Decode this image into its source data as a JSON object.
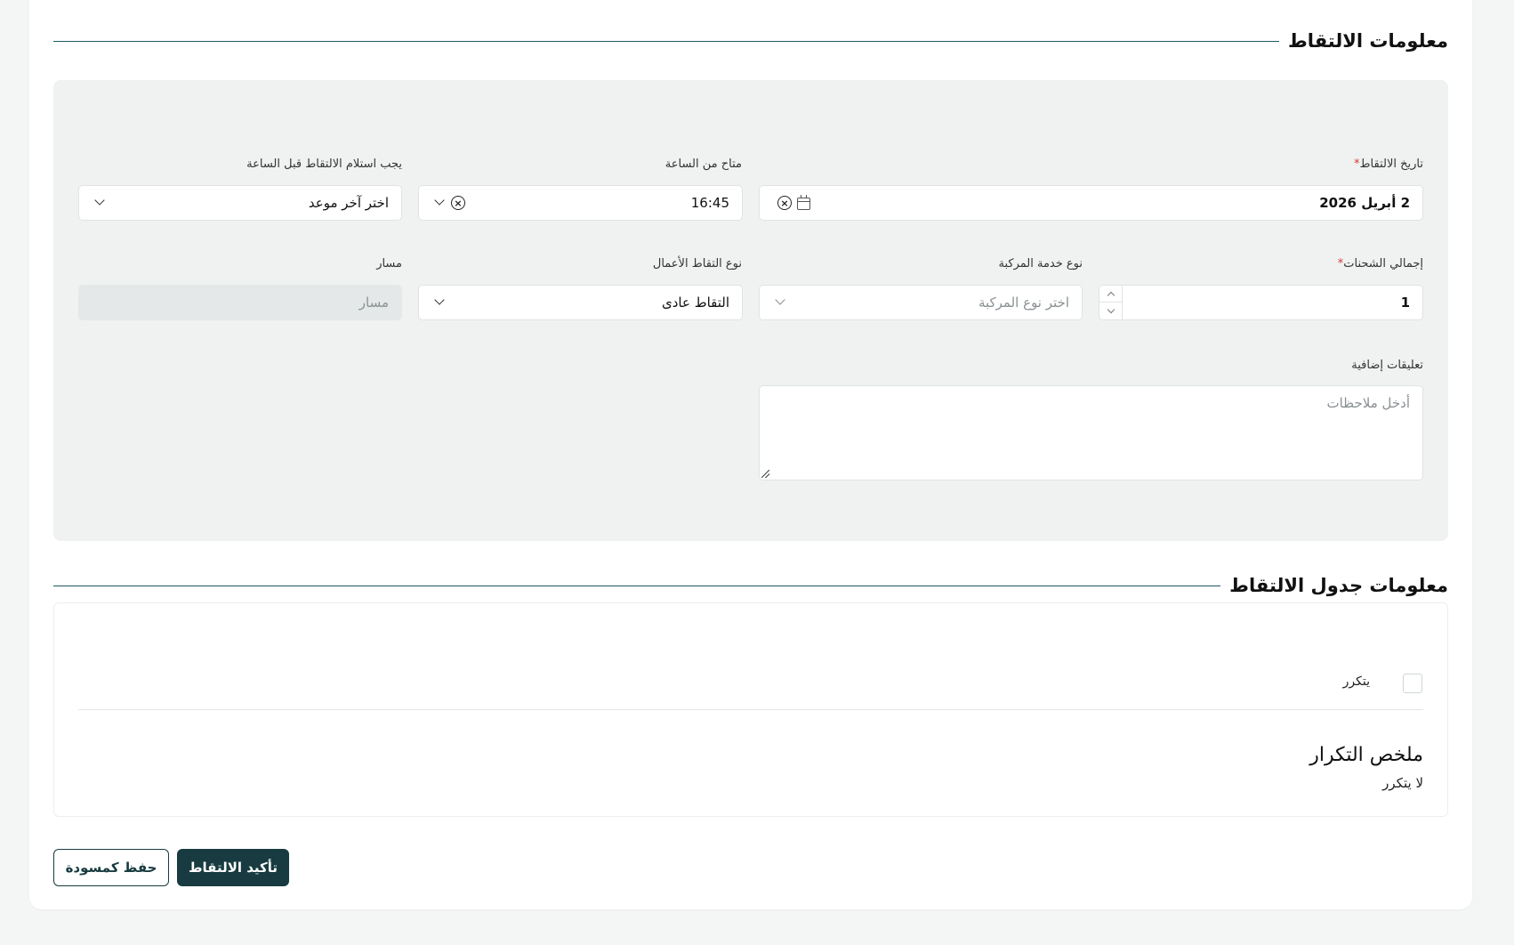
{
  "pickup_section": {
    "title": "معلومات الالتقاط",
    "pickup_date": {
      "label": "تاريخ الالتقاط",
      "required_mark": "*",
      "value": "2 أبريل 2026"
    },
    "available_from": {
      "label": "متاح من الساعة",
      "value": "16:45"
    },
    "must_pickup_before": {
      "label": "يجب استلام الالتقاط قبل الساعة",
      "value": "اختر آخر موعد"
    },
    "total_shipments": {
      "label": "إجمالي الشحنات",
      "required_mark": "*",
      "value": "1"
    },
    "vehicle_service_type": {
      "label": "نوع خدمة المركبة",
      "placeholder": "اختر نوع المركبة"
    },
    "business_pickup_type": {
      "label": "نوع التقاط الأعمال",
      "value": "التقاط عادى"
    },
    "route": {
      "label": "مسار",
      "placeholder": "مسار"
    },
    "comments": {
      "label": "تعليقات إضافية",
      "placeholder": "أدخل ملاحظات"
    }
  },
  "schedule_section": {
    "title": "معلومات جدول الالتقاط",
    "recurring_label": "يتكرر",
    "recurring_checked": false,
    "summary_title": "ملخص التكرار",
    "summary_text": "لا يتكرر"
  },
  "actions": {
    "confirm_label": "تأكيد الالتقاط",
    "save_draft_label": "حفظ كمسودة"
  },
  "colors": {
    "primary": "#173b40",
    "rule": "#1d5a63",
    "panel_bg": "#f0f2f1",
    "required": "#d23b3b"
  },
  "icons": [
    "calendar-icon",
    "clear-icon",
    "chevron-down-icon",
    "chevron-up-icon",
    "resize-handle-icon"
  ]
}
